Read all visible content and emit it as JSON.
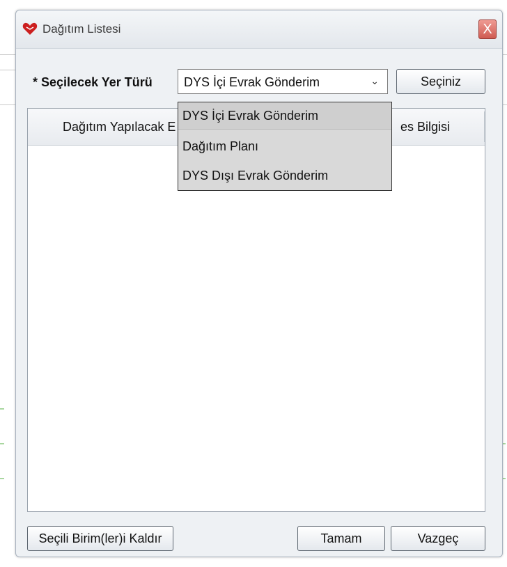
{
  "window": {
    "title": "Dağıtım Listesi",
    "close_symbol": "X"
  },
  "form": {
    "field_required_mark": "*",
    "field_label": "Seçilecek Yer Türü",
    "select_value": "DYS İçi Evrak Gönderim",
    "select_arrow": "⌄",
    "select_button_label": "Seçiniz"
  },
  "dropdown": {
    "options": [
      "DYS İçi Evrak Gönderim",
      "Dağıtım Planı",
      "DYS Dışı Evrak Gönderim"
    ],
    "selected": "DYS İçi Evrak Gönderim"
  },
  "table": {
    "column_1_visible_fragment": "Dağıtım Yapılacak E",
    "column_2_visible_fragment": "es Bilgisi",
    "rows": []
  },
  "footer": {
    "remove_button": "Seçili Birim(ler)i Kaldır",
    "ok_button": "Tamam",
    "cancel_button": "Vazgeç"
  },
  "colors": {
    "app_icon": "#cc1f1f",
    "close_button": "#d9655c",
    "dialog_bg": "#eef1f4"
  },
  "icons": {
    "app": "heart-envelope-icon",
    "close": "close-icon",
    "dropdown_arrow": "chevron-down-icon"
  }
}
